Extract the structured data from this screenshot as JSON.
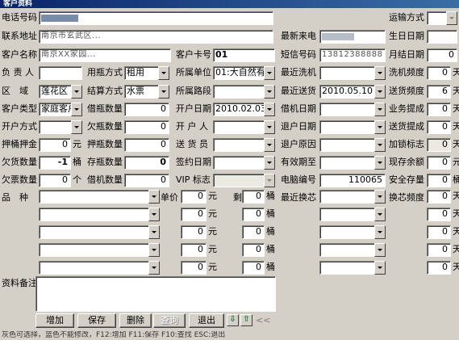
{
  "window": {
    "title": "客户资料"
  },
  "fields": {
    "phone": {
      "label": "电话号码",
      "value": ""
    },
    "transport": {
      "label": "运输方式",
      "value": ""
    },
    "address": {
      "label": "联系地址",
      "value": "南京市玄武区..."
    },
    "latest_phone": {
      "label": "最新来电",
      "value": ""
    },
    "birthday": {
      "label": "生日日期",
      "value": ""
    },
    "customer_name": {
      "label": "客户名称",
      "value": "南京XX家园..."
    },
    "card_no": {
      "label": "客户卡号",
      "value": "01"
    },
    "sms_no": {
      "label": "短信号码",
      "value": "13812388888"
    },
    "month_end": {
      "label": "月结日期",
      "value": "0"
    },
    "manager": {
      "label": "负 责 人",
      "value": ""
    },
    "bottle_mode": {
      "label": "用瓶方式",
      "value": "租用"
    },
    "unit": {
      "label": "所属单位",
      "value": "01:大自然有"
    },
    "last_wash": {
      "label": "最近洗机",
      "value": ""
    },
    "wash_freq": {
      "label": "洗机频度",
      "value": "0",
      "unit": "天"
    },
    "district": {
      "label": "区　域",
      "value": "莲花区"
    },
    "settle": {
      "label": "结算方式",
      "value": "水票"
    },
    "route": {
      "label": "所属路段",
      "value": ""
    },
    "last_deliver": {
      "label": "最近送货",
      "value": "2010.05.10"
    },
    "deliver_freq": {
      "label": "送货频度",
      "value": "6",
      "unit": "天"
    },
    "cust_type": {
      "label": "客户类型",
      "value": "家庭客户"
    },
    "borrow_bottle": {
      "label": "借瓶数量",
      "value": "0"
    },
    "open_date": {
      "label": "开户日期",
      "value": "2010.02.03"
    },
    "borrow_date": {
      "label": "借机日期",
      "value": ""
    },
    "biz_remind": {
      "label": "业务提成",
      "value": "0",
      "unit": "天"
    },
    "open_mode": {
      "label": "开户方式",
      "value": ""
    },
    "owe_bottle": {
      "label": "欠瓶数量",
      "value": "0"
    },
    "opener": {
      "label": "开 户 人",
      "value": ""
    },
    "cancel_date": {
      "label": "退户日期",
      "value": ""
    },
    "deliver_remind": {
      "label": "送货提成",
      "value": "0",
      "unit": "天"
    },
    "deposit": {
      "label": "押桶押金",
      "value": "0",
      "unit": "元"
    },
    "deposit_bottle": {
      "label": "押瓶数量",
      "value": "0"
    },
    "delivery_person": {
      "label": "送 货 员",
      "value": ""
    },
    "cancel_reason": {
      "label": "退户原因",
      "value": ""
    },
    "lock_flag": {
      "label": "加锁标志",
      "value": "0",
      "unit": "天"
    },
    "owe_goods": {
      "label": "欠货数量",
      "value": "-1",
      "unit": "桶"
    },
    "stock_bottle": {
      "label": "存瓶数量",
      "value": "0"
    },
    "sign_date": {
      "label": "签约日期",
      "value": ""
    },
    "valid_until": {
      "label": "有效期至",
      "value": ""
    },
    "balance": {
      "label": "现存余额",
      "value": "0",
      "unit": "元"
    },
    "owe_ticket": {
      "label": "欠票数量",
      "value": "0",
      "unit": "个"
    },
    "borrow_machine": {
      "label": "借机数量",
      "value": "0"
    },
    "vip": {
      "label": "VIP 标志",
      "value": ""
    },
    "pc_no": {
      "label": "电脑编号",
      "value": "110065"
    },
    "safe_stock": {
      "label": "安全存量",
      "value": "0",
      "unit": "桶"
    }
  },
  "products": {
    "label": "品　种",
    "price_label": "单价",
    "yuan": "元",
    "remain_label": "剩余",
    "bucket": "桶",
    "rows": [
      {
        "name": "",
        "price": "0",
        "remain": "0"
      },
      {
        "name": "",
        "price": "0",
        "remain": "0"
      },
      {
        "name": "",
        "price": "0",
        "remain": "0"
      },
      {
        "name": "",
        "price": "0",
        "remain": "0"
      },
      {
        "name": "",
        "price": "0",
        "remain": "0"
      }
    ]
  },
  "filter": {
    "label": "最近换芯",
    "freq_label": "换芯频度",
    "unit": "天",
    "rows": [
      {
        "date": "",
        "freq": "0"
      },
      {
        "date": "",
        "freq": "0"
      },
      {
        "date": "",
        "freq": "0"
      },
      {
        "date": "",
        "freq": "0"
      },
      {
        "date": "",
        "freq": "0"
      }
    ]
  },
  "remarks": {
    "label": "资料备注",
    "value": ""
  },
  "buttons": {
    "add": "增加",
    "save": "保存",
    "delete": "删除",
    "query": "查询",
    "exit": "退出",
    "more": "<<"
  },
  "status_text": "灰色可选择，蓝色不能修改，F12:增加 F11:保存 F10:查找 ESC:退出"
}
